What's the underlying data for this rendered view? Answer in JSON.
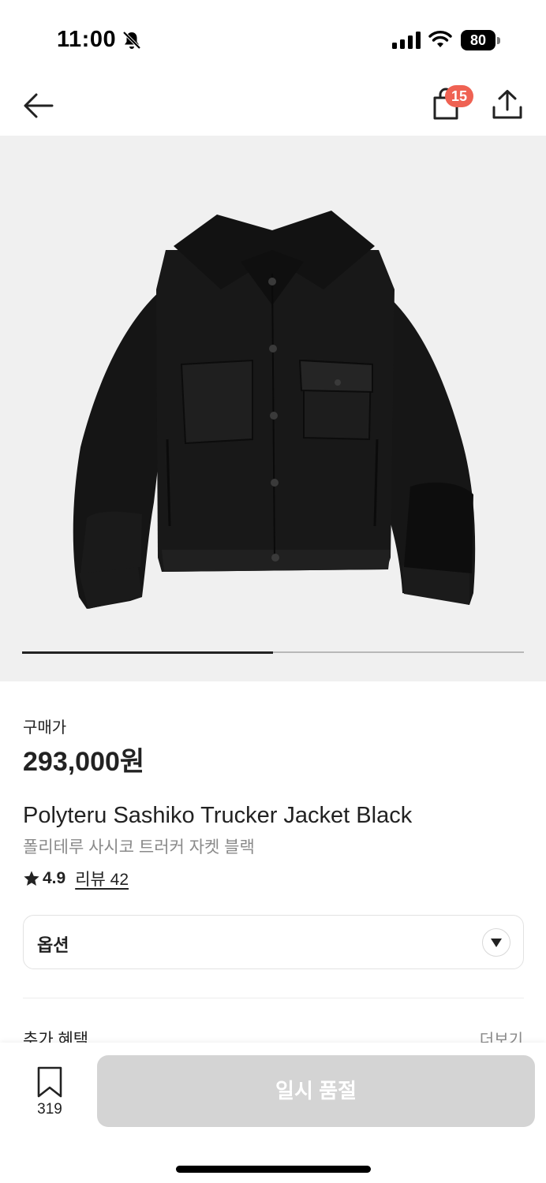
{
  "status_bar": {
    "time": "11:00",
    "battery": "80",
    "icons": [
      "bell-slash-icon",
      "cellular-signal-icon",
      "wifi-icon",
      "battery-icon"
    ]
  },
  "nav": {
    "back_icon": "arrow-left-icon",
    "bag_icon": "shopping-bag-icon",
    "bag_count": "15",
    "share_icon": "share-icon",
    "badge_color": "#ef6253"
  },
  "gallery": {
    "image": "black-trucker-jacket-photo",
    "page_fraction": 0.5
  },
  "price": {
    "label": "구매가",
    "value": "293,000원"
  },
  "product": {
    "name": "Polyteru Sashiko Trucker Jacket Black",
    "subtitle": "폴리테루 사시코 트러커 자켓 블랙"
  },
  "rating": {
    "value": "4.9",
    "review_label": "리뷰 42"
  },
  "options": {
    "label": "옵션"
  },
  "benefits": {
    "title": "추가 혜택",
    "more": "더보기"
  },
  "bottom_bar": {
    "bookmark_count": "319",
    "button_label": "일시 품절",
    "button_color": "#d4d4d4"
  }
}
